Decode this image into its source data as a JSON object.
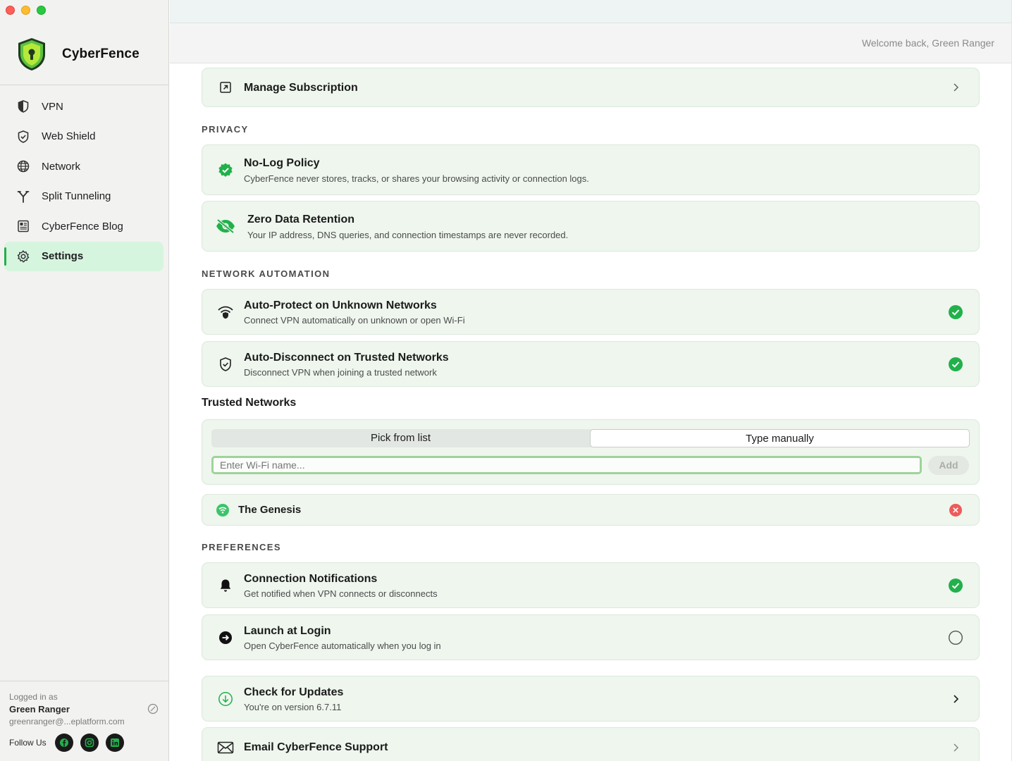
{
  "window": {
    "title": ""
  },
  "brand": {
    "name": "CyberFence"
  },
  "sidebar": {
    "items": [
      {
        "label": "VPN",
        "icon": "half-shield-icon"
      },
      {
        "label": "Web Shield",
        "icon": "shield-check-icon"
      },
      {
        "label": "Network",
        "icon": "globe-icon"
      },
      {
        "label": "Split Tunneling",
        "icon": "split-icon"
      },
      {
        "label": "CyberFence Blog",
        "icon": "newspaper-icon"
      },
      {
        "label": "Settings",
        "icon": "gear-icon",
        "active": true
      }
    ],
    "user": {
      "logged_in_label": "Logged in as",
      "name": "Green Ranger",
      "email": "greenranger@...eplatform.com"
    },
    "follow_label": "Follow Us",
    "social": [
      "facebook-icon",
      "instagram-icon",
      "linkedin-icon"
    ]
  },
  "header": {
    "welcome": "Welcome back, Green Ranger"
  },
  "main": {
    "manage_subscription": "Manage Subscription",
    "privacy_label": "PRIVACY",
    "no_log": {
      "title": "No-Log Policy",
      "subtitle": "CyberFence never stores, tracks, or shares your browsing activity or connection logs."
    },
    "zero_data": {
      "title": "Zero Data Retention",
      "subtitle": "Your IP address, DNS queries, and connection timestamps are never recorded."
    },
    "network_automation_label": "NETWORK AUTOMATION",
    "auto_protect": {
      "title": "Auto-Protect on Unknown Networks",
      "subtitle": "Connect VPN automatically on unknown or open Wi-Fi",
      "enabled": true
    },
    "auto_disconnect": {
      "title": "Auto-Disconnect on Trusted Networks",
      "subtitle": "Disconnect VPN when joining a trusted network",
      "enabled": true
    },
    "trusted_networks": {
      "heading": "Trusted Networks",
      "tabs": [
        "Pick from list",
        "Type manually"
      ],
      "selected_tab": "Type manually",
      "input_placeholder": "Enter Wi-Fi name...",
      "input_value": "",
      "add_label": "Add",
      "networks": [
        "The Genesis"
      ]
    },
    "preferences_label": "PREFERENCES",
    "notifications": {
      "title": "Connection Notifications",
      "subtitle": "Get notified when VPN connects or disconnects",
      "enabled": true
    },
    "launch_login": {
      "title": "Launch at Login",
      "subtitle": "Open CyberFence automatically when you log in",
      "enabled": false
    },
    "updates": {
      "title": "Check for Updates",
      "subtitle": "You're on version 6.7.11"
    },
    "support": {
      "title": "Email CyberFence Support"
    }
  },
  "colors": {
    "accent": "#22b04b",
    "card_bg": "#eef6ee",
    "active_nav_bg": "#d6f5df",
    "danger": "#ee5a5a"
  }
}
